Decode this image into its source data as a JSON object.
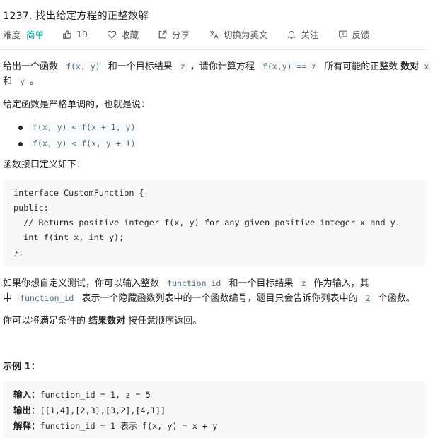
{
  "problem": {
    "title": "1237. 找出给定方程的正整数解",
    "difficulty_label": "难度",
    "difficulty": "简单",
    "likes": "19",
    "actions": {
      "favorite": "收藏",
      "share": "分享",
      "switch_lang": "切换为英文",
      "follow": "关注",
      "feedback": "反馈"
    }
  },
  "description": {
    "p1": {
      "t1": "给出一个函数 ",
      "c1": "f(x, y)",
      "t2": " 和一个目标结果 ",
      "c2": "z",
      "t3": "，请你计算方程 ",
      "c3": "f(x,y) == z",
      "t4": " 所有可能的正整数 ",
      "bold": "数对",
      "c4": "x",
      "line2_t1": "和 ",
      "line2_c1": "y",
      "line2_t2": "。"
    },
    "p2": "给定函数是严格单调的，也就是说：",
    "bullets": [
      "f(x, y) < f(x + 1, y)",
      "f(x, y) < f(x, y + 1)"
    ],
    "p3": "函数接口定义如下：",
    "interface_code": [
      "interface CustomFunction {",
      "public:",
      "  // Returns positive integer f(x, y) for any given positive integer x and y.",
      "  int f(int x, int y);",
      "};"
    ],
    "p4": {
      "t1": "如果你想自定义测试，你可以输入整数 ",
      "c1": "function_id",
      "t2": " 和一个目标结果 ",
      "c2": "z",
      "t3": " 作为输入，其",
      "l2_t1": "中 ",
      "l2_c1": "function_id",
      "l2_t2": " 表示一个隐藏函数列表中的一个函数编号，题目只会告诉你列表中的 ",
      "l2_c2": "2",
      "l2_t3": " 个函数。"
    },
    "p5": {
      "t1": "你可以将满足条件的 ",
      "bold": "结果数对",
      "t2": " 按任意顺序返回。"
    },
    "example1": {
      "heading": "示例 1：",
      "input_label": "输入：",
      "input": "function_id = 1, z = 5",
      "output_label": "输出：",
      "output": "[[1,4],[2,3],[3,2],[4,1]]",
      "explain_label": "解释：",
      "explain": "function_id = 1 表示 f(x, y) = x + y"
    }
  }
}
